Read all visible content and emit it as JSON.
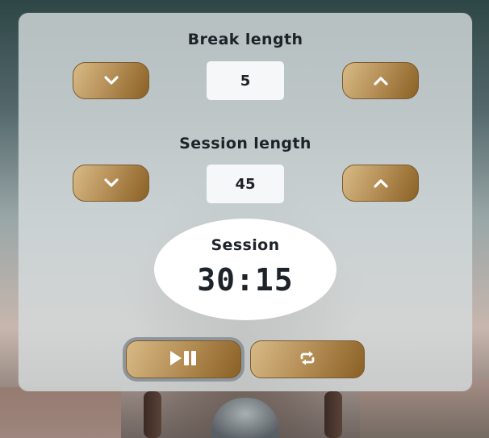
{
  "break": {
    "label": "Break length",
    "value": "5",
    "decrement_icon": "chevron-down-icon",
    "increment_icon": "chevron-up-icon"
  },
  "session": {
    "label": "Session length",
    "value": "45",
    "decrement_icon": "chevron-down-icon",
    "increment_icon": "chevron-up-icon"
  },
  "timer": {
    "label": "Session",
    "time": "30:15"
  },
  "controls": {
    "play_pause_icon": "play-pause-icon",
    "reset_icon": "repeat-icon"
  },
  "colors": {
    "button_gradient_light": "#d8ba86",
    "button_gradient_dark": "#8a6024",
    "text": "#1d2329",
    "value_box": "#f5f7f8"
  }
}
